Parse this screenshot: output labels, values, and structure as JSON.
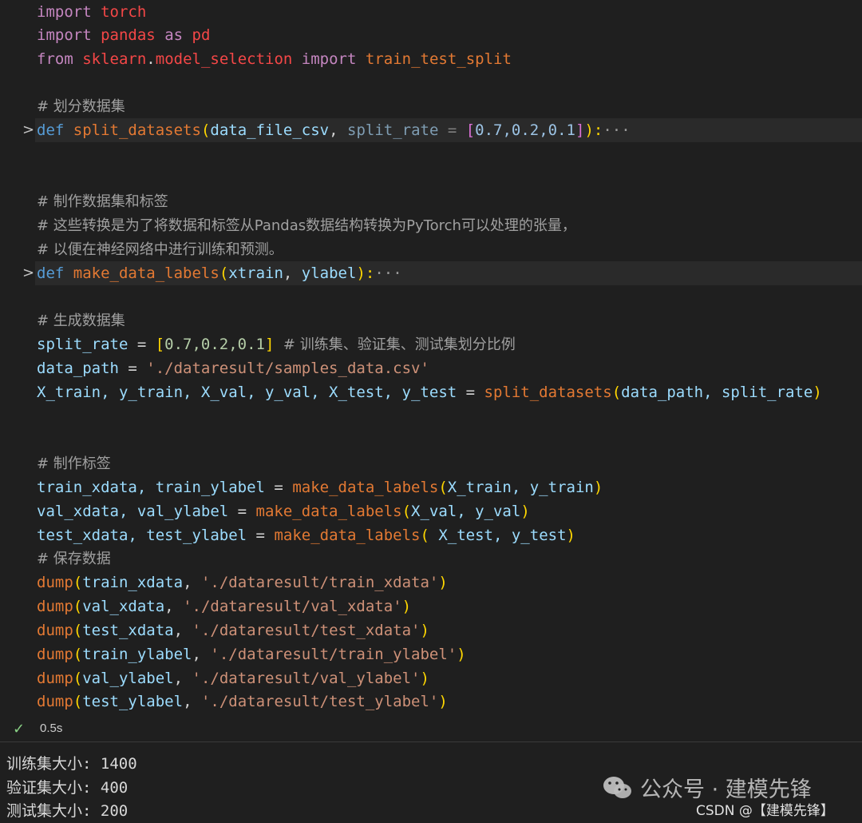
{
  "code": {
    "l1": {
      "kw": "import",
      "mod": "torch"
    },
    "l2": {
      "kw": "import",
      "mod": "pandas",
      "as": "as",
      "alias": "pd"
    },
    "l3": {
      "kw": "from",
      "mod1": "sklearn",
      "dot": ".",
      "mod2": "model_selection",
      "kw2": "import",
      "fn": "train_test_split"
    },
    "c1": "# 划分数据集",
    "def1": {
      "kw": "def",
      "name": "split_datasets",
      "open": "(",
      "a1": "data_file_csv",
      "comma": ", ",
      "a2": "split_rate",
      "eq": " = ",
      "lb": "[",
      "v": "0.7,0.2,0.1",
      "rb": "]",
      "close": "):",
      "ell": "···"
    },
    "c2": "# 制作数据集和标签",
    "c3": "# 这些转换是为了将数据和标签从Pandas数据结构转换为PyTorch可以处理的张量，",
    "c4": "# 以便在神经网络中进行训练和预测。",
    "def2": {
      "kw": "def",
      "name": "make_data_labels",
      "open": "(",
      "a1": "xtrain",
      "comma": ", ",
      "a2": "ylabel",
      "close": "):",
      "ell": "···"
    },
    "c5": "# 生成数据集",
    "l_rate": {
      "var": "split_rate",
      "eq": " = ",
      "lb": "[",
      "v": "0.7,0.2,0.1",
      "rb": "]",
      "com": "  # 训练集、验证集、测试集划分比例"
    },
    "l_path": {
      "var": "data_path",
      "eq": " = ",
      "str": "'./dataresult/samples_data.csv'"
    },
    "l_split": {
      "lhs": "X_train, y_train, X_val, y_val, X_test, y_test",
      "eq": " = ",
      "fn": "split_datasets",
      "open": "(",
      "args": "data_path, split_rate",
      "close": ")"
    },
    "c6": "# 制作标签",
    "m1": {
      "lhs": "train_xdata, train_ylabel",
      "eq": " = ",
      "fn": "make_data_labels",
      "open": "(",
      "args": "X_train, y_train",
      "close": ")"
    },
    "m2": {
      "lhs": "val_xdata, val_ylabel",
      "eq": " = ",
      "fn": "make_data_labels",
      "open": "(",
      "args": "X_val, y_val",
      "close": ")"
    },
    "m3": {
      "lhs": "test_xdata, test_ylabel",
      "eq": " = ",
      "fn": "make_data_labels",
      "open": "(",
      "args": " X_test, y_test",
      "close": ")"
    },
    "c7": "# 保存数据",
    "dumps": [
      {
        "fn": "dump",
        "arg": "train_xdata",
        "str": "'./dataresult/train_xdata'"
      },
      {
        "fn": "dump",
        "arg": "val_xdata",
        "str": "'./dataresult/val_xdata'"
      },
      {
        "fn": "dump",
        "arg": "test_xdata",
        "str": "'./dataresult/test_xdata'"
      },
      {
        "fn": "dump",
        "arg": "train_ylabel",
        "str": "'./dataresult/train_ylabel'"
      },
      {
        "fn": "dump",
        "arg": "val_ylabel",
        "str": "'./dataresult/val_ylabel'"
      },
      {
        "fn": "dump",
        "arg": "test_ylabel",
        "str": "'./dataresult/test_ylabel'"
      }
    ]
  },
  "status": {
    "check": "✓",
    "time": "0.5s"
  },
  "output": [
    "训练集大小: 1400",
    "验证集大小: 400",
    "测试集大小: 200"
  ],
  "watermark": {
    "main": "公众号 · 建模先锋",
    "sub": "CSDN @【建模先锋】"
  },
  "icons": {
    "fold": "chevron-right-icon",
    "status": "check-icon",
    "watermark": "wechat-icon"
  }
}
